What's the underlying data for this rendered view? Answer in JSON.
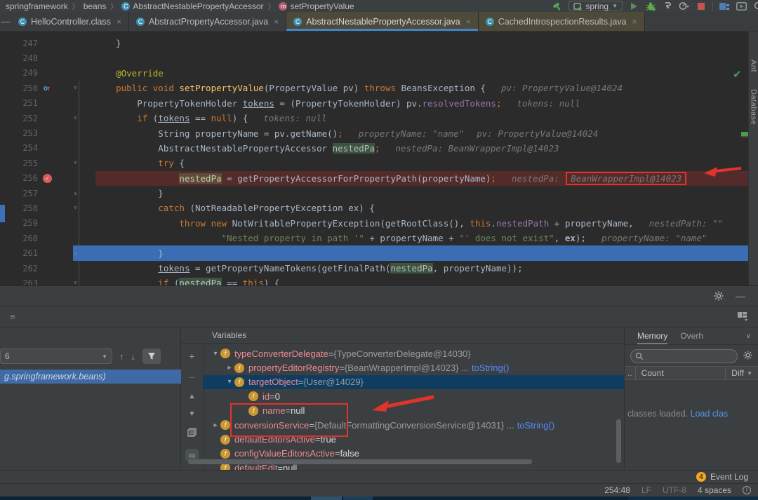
{
  "colors": {
    "accent_blue": "#4083c9",
    "annotation_red": "#e0342b",
    "link_blue": "#5394ec",
    "breakpoint_red": "#db5c5c",
    "event_badge_orange": "#f5a623",
    "current_line_blue": "#3a6db4"
  },
  "breadcrumb": {
    "items": [
      {
        "label": "springframework",
        "icon": null
      },
      {
        "label": "beans",
        "icon": null
      },
      {
        "label": "AbstractNestablePropertyAccessor",
        "icon": "class"
      },
      {
        "label": "setPropertyValue",
        "icon": "method"
      }
    ]
  },
  "toolbar": {
    "run_config": "spring"
  },
  "tab_bar": {
    "tabs": [
      {
        "label": "HelloController.class",
        "state": "normal"
      },
      {
        "label": "AbstractPropertyAccessor.java",
        "state": "normal"
      },
      {
        "label": "AbstractNestablePropertyAccessor.java",
        "state": "active"
      },
      {
        "label": "CachedIntrospectionResults.java",
        "state": "library"
      }
    ]
  },
  "editor": {
    "right_tabs": [
      "Ant",
      "Database"
    ],
    "lines": [
      {
        "num": "247",
        "segs": [
          [
            "d",
            "    }"
          ]
        ]
      },
      {
        "num": "248",
        "segs": []
      },
      {
        "num": "249",
        "segs": [
          [
            "ann",
            "    @Override"
          ]
        ]
      },
      {
        "num": "250",
        "g": "override",
        "fold": "open",
        "segs": [
          [
            "k",
            "    public void "
          ],
          [
            "m",
            "setPropertyValue"
          ],
          [
            "d",
            "(PropertyValue pv) "
          ],
          [
            "k",
            "throws"
          ],
          [
            "d",
            " BeansException {"
          ]
        ],
        "hints": [
          {
            "text": "pv: PropertyValue@14024"
          }
        ]
      },
      {
        "num": "251",
        "segs": [
          [
            "d",
            "        PropertyTokenHolder "
          ],
          [
            "fu",
            "tokens"
          ],
          [
            "d",
            " = (PropertyTokenHolder) pv."
          ],
          [
            "f",
            "resolvedTokens"
          ],
          [
            "sc",
            ";"
          ]
        ],
        "hints": [
          {
            "text": "tokens: null"
          }
        ]
      },
      {
        "num": "252",
        "fold": "open",
        "segs": [
          [
            "k",
            "        if"
          ],
          [
            "d",
            " ("
          ],
          [
            "fu",
            "tokens"
          ],
          [
            "d",
            " == "
          ],
          [
            "k",
            "null"
          ],
          [
            "d",
            ") {"
          ]
        ],
        "hints": [
          {
            "text": "tokens: null"
          }
        ]
      },
      {
        "num": "253",
        "segs": [
          [
            "d",
            "            String propertyName = pv.getName()"
          ],
          [
            "sc",
            ";"
          ]
        ],
        "hints": [
          {
            "text": "propertyName: \"name\""
          },
          {
            "text": "pv: PropertyValue@14024",
            "gap": 18
          }
        ]
      },
      {
        "num": "254",
        "segs": [
          [
            "d",
            "            AbstractNestablePropertyAccessor "
          ],
          [
            "hlg",
            "nestedPa"
          ],
          [
            "sc",
            ";"
          ]
        ],
        "hints": [
          {
            "text": "nestedPa: BeanWrapperImpl@14023"
          }
        ]
      },
      {
        "num": "255",
        "fold": "open",
        "segs": [
          [
            "k",
            "            try"
          ],
          [
            "d",
            " {"
          ]
        ]
      },
      {
        "num": "256",
        "g": "breakpoint",
        "hl": "red",
        "segs": [
          [
            "d",
            "                "
          ],
          [
            "hlt",
            "nestedPa"
          ],
          [
            "d",
            " = getPropertyAccessorForPropertyPath(propertyName)"
          ],
          [
            "sc",
            ";"
          ]
        ],
        "hints": [
          {
            "text": "nestedPa: "
          },
          {
            "text": "BeanWrapperImpl@14023",
            "boxed": true,
            "gap": 2
          }
        ]
      },
      {
        "num": "257",
        "fold": "end",
        "segs": [
          [
            "d",
            "            }"
          ]
        ]
      },
      {
        "num": "258",
        "fold": "open",
        "segs": [
          [
            "k",
            "            catch"
          ],
          [
            "d",
            " (NotReadablePropertyException ex) {"
          ]
        ]
      },
      {
        "num": "259",
        "segs": [
          [
            "k",
            "                throw new"
          ],
          [
            "d",
            " NotWritablePropertyException(getRootClass(), "
          ],
          [
            "k",
            "this"
          ],
          [
            "d",
            "."
          ],
          [
            "f",
            "nestedPath"
          ],
          [
            "d",
            " + propertyName,"
          ]
        ],
        "hints": [
          {
            "text": "nestedPath: \"\""
          }
        ]
      },
      {
        "num": "260",
        "segs": [
          [
            "s",
            "                        \"Nested property in path '\""
          ],
          [
            "d",
            " + propertyName + "
          ],
          [
            "s",
            "\"' does not exist\""
          ],
          [
            "d",
            ", "
          ],
          [
            "b",
            "ex"
          ],
          [
            "d",
            ");"
          ]
        ],
        "hints": [
          {
            "text": "propertyName: \"name\""
          }
        ]
      },
      {
        "num": "261",
        "fold": "end",
        "hl": "blue",
        "segs": [
          [
            "d",
            "            }"
          ]
        ]
      },
      {
        "num": "262",
        "segs": [
          [
            "d",
            "            "
          ],
          [
            "fu",
            "tokens"
          ],
          [
            "d",
            " = getPropertyNameTokens(getFinalPath("
          ],
          [
            "hlg",
            "nestedPa"
          ],
          [
            "d",
            ", propertyName));"
          ]
        ]
      },
      {
        "num": "263",
        "fold": "open",
        "segs": [
          [
            "k",
            "            if"
          ],
          [
            "d",
            " ("
          ],
          [
            "hlg",
            "nestedPa"
          ],
          [
            "d",
            " == "
          ],
          [
            "k",
            "this"
          ],
          [
            "d",
            ") {"
          ]
        ]
      }
    ]
  },
  "frames": {
    "combo_text": "6",
    "frame_text": "g.springframework.beans)"
  },
  "variables": {
    "title": "Variables",
    "rows": [
      {
        "level": 0,
        "exp": "open",
        "name": "typeConverterDelegate",
        "value": "{TypeConverterDelegate@14030}"
      },
      {
        "level": 1,
        "exp": "closed",
        "name": "propertyEditorRegistry",
        "value": "{BeanWrapperImpl@14023} ...",
        "link": "toString()"
      },
      {
        "level": 1,
        "exp": "open",
        "name": "targetObject",
        "value": "{User@14029}",
        "selected": true
      },
      {
        "level": 2,
        "name": "id",
        "plain": "0"
      },
      {
        "level": 2,
        "name": "name",
        "plain": "null"
      },
      {
        "level": 0,
        "exp": "closed",
        "name": "conversionService",
        "value": "{DefaultFormattingConversionService@14031} ...",
        "link": "toString()"
      },
      {
        "level": 0,
        "name": "defaultEditorsActive",
        "plain": "true"
      },
      {
        "level": 0,
        "name": "configValueEditorsActive",
        "plain": "false"
      },
      {
        "level": 0,
        "name": "defaultEdit",
        "plain": "null",
        "clipped": true
      }
    ]
  },
  "memory": {
    "tabs": [
      "Memory",
      "Overh"
    ],
    "columns": [
      "..",
      "Count",
      "Diff"
    ],
    "status_text": "classes loaded.",
    "link_text": "Load clas"
  },
  "event_log": {
    "count": "4",
    "label": "Event Log"
  },
  "status_bar": {
    "caret": "254:48",
    "line_ending": "LF",
    "encoding": "UTF-8",
    "indent": "4 spaces"
  }
}
